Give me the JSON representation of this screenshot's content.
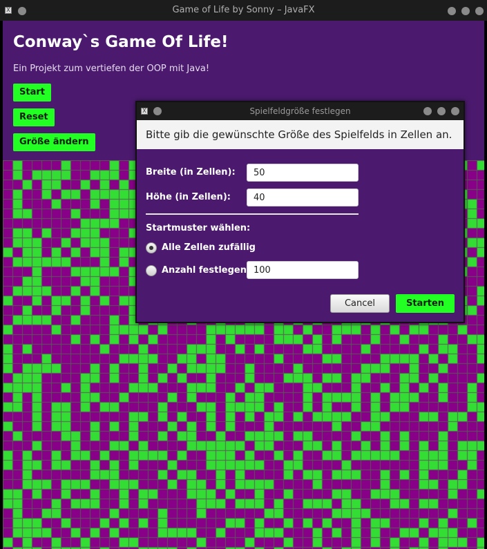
{
  "window": {
    "title": "Game of Life by Sonny – JavaFX",
    "app_icon_glyph": "X"
  },
  "main": {
    "heading": "Conway`s Game Of Life!",
    "subtitle": "Ein Projekt zum vertiefen der OOP mit Java!",
    "start_label": "Start",
    "reset_label": "Reset",
    "resize_label": "Größe ändern"
  },
  "board": {
    "alive_color": "#33dd33",
    "dead_color": "#880088",
    "grid_color": "#5a5a5a"
  },
  "dialog": {
    "title": "Spielfeldgröße festlegen",
    "header": "Bitte gib die gewünschte Größe des Spielfelds in Zellen an.",
    "width_label": "Breite (in Zellen):",
    "width_value": "50",
    "height_label": "Höhe (in Zellen):",
    "height_value": "40",
    "pattern_label": "Startmuster wählen:",
    "option_random": "Alle Zellen zufällig",
    "option_count": "Anzahl festlegen:",
    "count_value": "100",
    "cancel_label": "Cancel",
    "confirm_label": "Starten"
  },
  "colors": {
    "accent_green": "#22ff22",
    "panel_purple": "#4b1a6e",
    "titlebar": "#1c1c1c"
  }
}
